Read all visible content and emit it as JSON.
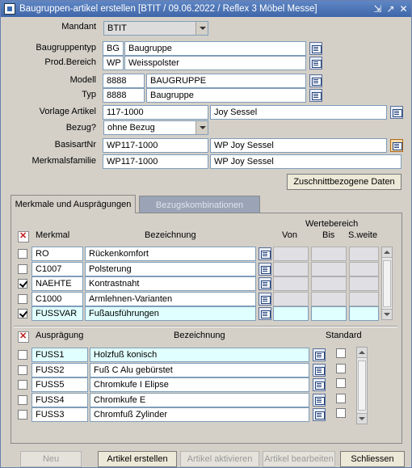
{
  "window": {
    "title": "Baugruppen-artikel erstellen   [BTIT / 09.06.2022 / Reflex 3 Möbel Messe]"
  },
  "header": {
    "mandant": {
      "label": "Mandant",
      "value": "BTIT"
    },
    "baugruppentyp": {
      "label": "Baugruppentyp",
      "code": "BG",
      "name": "Baugruppe"
    },
    "prod_bereich": {
      "label": "Prod.Bereich",
      "code": "WP",
      "name": "Weisspolster"
    },
    "modell": {
      "label": "Modell",
      "code": "8888",
      "name": "BAUGRUPPE"
    },
    "typ": {
      "label": "Typ",
      "code": "8888",
      "name": "Baugruppe"
    },
    "vorlage_artikel": {
      "label": "Vorlage Artikel",
      "code": "117-1000",
      "name": "Joy Sessel"
    },
    "bezug": {
      "label": "Bezug?",
      "value": "ohne Bezug"
    },
    "basisartnr": {
      "label": "BasisartNr",
      "code": "WP117-1000",
      "name": "WP Joy Sessel"
    },
    "merkmalsfamilie": {
      "label": "Merkmalsfamilie",
      "code": "WP117-1000",
      "name": "WP Joy Sessel"
    },
    "zuschnitt_button": "Zuschnittbezogene Daten"
  },
  "tabs": [
    {
      "label": "Merkmale und Ausprägungen",
      "active": true
    },
    {
      "label": "Bezugskombinationen",
      "active": false
    }
  ],
  "merkmale": {
    "col_merkmal": "Merkmal",
    "col_bezeichnung": "Bezeichnung",
    "wertebereich": "Wertebereich",
    "col_von": "Von",
    "col_bis": "Bis",
    "col_sweite": "S.weite",
    "rows": [
      {
        "checked": false,
        "code": "RO",
        "bezeichnung": "Rückenkomfort",
        "highlight": false
      },
      {
        "checked": false,
        "code": "C1007",
        "bezeichnung": "Polsterung",
        "highlight": false
      },
      {
        "checked": true,
        "code": "NAEHTE",
        "bezeichnung": "Kontrastnaht",
        "highlight": false
      },
      {
        "checked": false,
        "code": "C1000",
        "bezeichnung": "Armlehnen-Varianten",
        "highlight": false
      },
      {
        "checked": true,
        "code": "FUSSVAR",
        "bezeichnung": "Fußausführungen",
        "highlight": true
      }
    ]
  },
  "auspraegungen": {
    "col_auspraegung": "Ausprägung",
    "col_bezeichnung": "Bezeichnung",
    "col_standard": "Standard",
    "rows": [
      {
        "checked": false,
        "code": "FUSS1",
        "bezeichnung": "Holzfuß konisch",
        "highlight": true,
        "standard": false
      },
      {
        "checked": false,
        "code": "FUSS2",
        "bezeichnung": "Fuß C Alu gebürstet",
        "highlight": false,
        "standard": false
      },
      {
        "checked": false,
        "code": "FUSS5",
        "bezeichnung": "Chromkufe I Elipse",
        "highlight": false,
        "standard": false
      },
      {
        "checked": false,
        "code": "FUSS4",
        "bezeichnung": "Chromkufe E",
        "highlight": false,
        "standard": false
      },
      {
        "checked": false,
        "code": "FUSS3",
        "bezeichnung": "Chromfuß Zylinder",
        "highlight": false,
        "standard": false
      }
    ]
  },
  "footer": {
    "neu": "Neu",
    "artikel_erstellen": "Artikel erstellen",
    "artikel_aktivieren": "Artikel aktivieren",
    "artikel_bearbeiten": "Artikel bearbeiten",
    "schliessen": "Schliessen"
  },
  "icons": {
    "window_controls": [
      "minimize-icon",
      "restore-icon",
      "close-icon"
    ],
    "lov": "list-of-values-icon",
    "delete": "delete-row-icon"
  },
  "colors": {
    "title_bar": "#4a72b5",
    "highlight_field": "#e0ffff",
    "window_bg": "#d4d0c8"
  }
}
